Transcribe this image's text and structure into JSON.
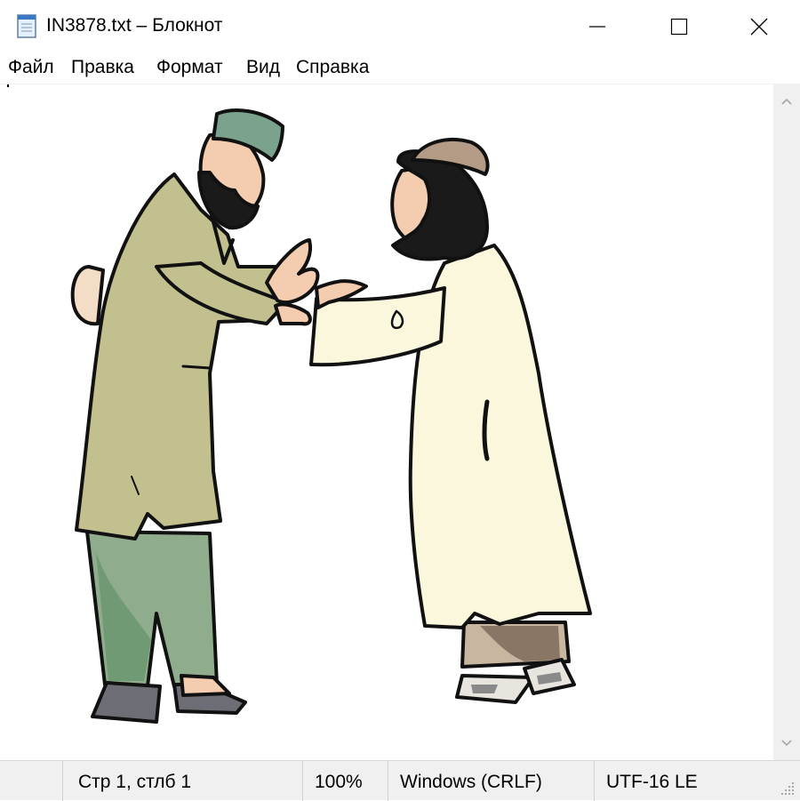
{
  "window": {
    "title": "IN3878.txt – Блокнот",
    "icon": "notepad-icon",
    "controls": [
      "minimize-icon",
      "maximize-icon",
      "close-icon"
    ]
  },
  "menu": {
    "items": [
      "Файл",
      "Правка",
      "Формат",
      "Вид",
      "Справка"
    ]
  },
  "editor": {
    "content_picture": "two-men-greeting-clipart"
  },
  "status": {
    "position": "Стр 1, стлб 1",
    "zoom": "100%",
    "line_endings": "Windows (CRLF)",
    "encoding": "UTF-16 LE"
  },
  "colors": {
    "chrome": "#f0f0f0",
    "left_robe": "#c2c08e",
    "left_cap": "#7aa28c",
    "left_trousers": "#8fac8c",
    "right_robe": "#fbf7dc",
    "skin": "#f4cdb0",
    "right_cap": "#b39b86"
  }
}
